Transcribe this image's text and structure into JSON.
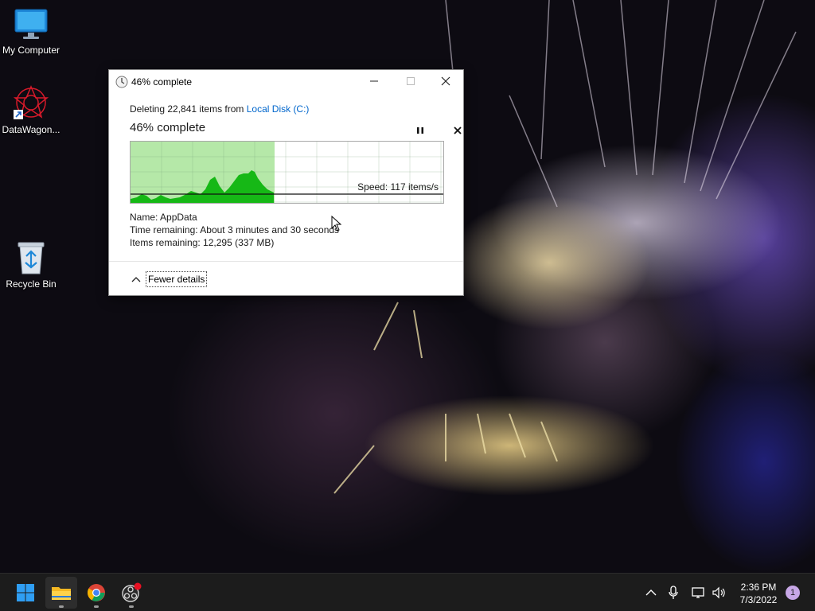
{
  "desktop": {
    "icons": [
      {
        "label": "My Computer",
        "icon": "monitor-icon"
      },
      {
        "label": "DataWagon...",
        "icon": "datawagon-app-icon"
      },
      {
        "label": "Recycle Bin",
        "icon": "recycle-bin-icon"
      }
    ]
  },
  "dialog": {
    "title": "46% complete",
    "title_icon": "clock-icon",
    "deleting_prefix": "Deleting 22,841 items from",
    "deleting_location": "Local Disk (C:)",
    "progress_heading": "46% complete",
    "progress_fraction": 0.46,
    "speed": "Speed: 117 items/s",
    "name_label": "Name:",
    "name_value": "AppData",
    "time_label": "Time remaining:",
    "time_value": "About 3 minutes and 30 seconds",
    "items_label": "Items remaining:",
    "items_value": "12,295 (337 MB)",
    "fewer_details": "Fewer details",
    "controls": [
      "pause-icon",
      "stop-icon"
    ],
    "window_buttons": [
      "minimize-icon",
      "maximize-icon",
      "close-icon"
    ]
  },
  "taskbar": {
    "apps": [
      "windows-start-icon",
      "file-explorer-icon",
      "chrome-icon",
      "obs-icon"
    ],
    "tray": [
      "chevron-up-icon",
      "microphone-icon",
      "network-icon",
      "speaker-icon"
    ],
    "time": "2:36 PM",
    "date": "7/3/2022",
    "notification_count": "1"
  },
  "colors": {
    "progress_fill": "#b5e8a8",
    "graph_fill": "#16b816",
    "link": "#0066cc",
    "taskbar": "#1c1c1c"
  }
}
